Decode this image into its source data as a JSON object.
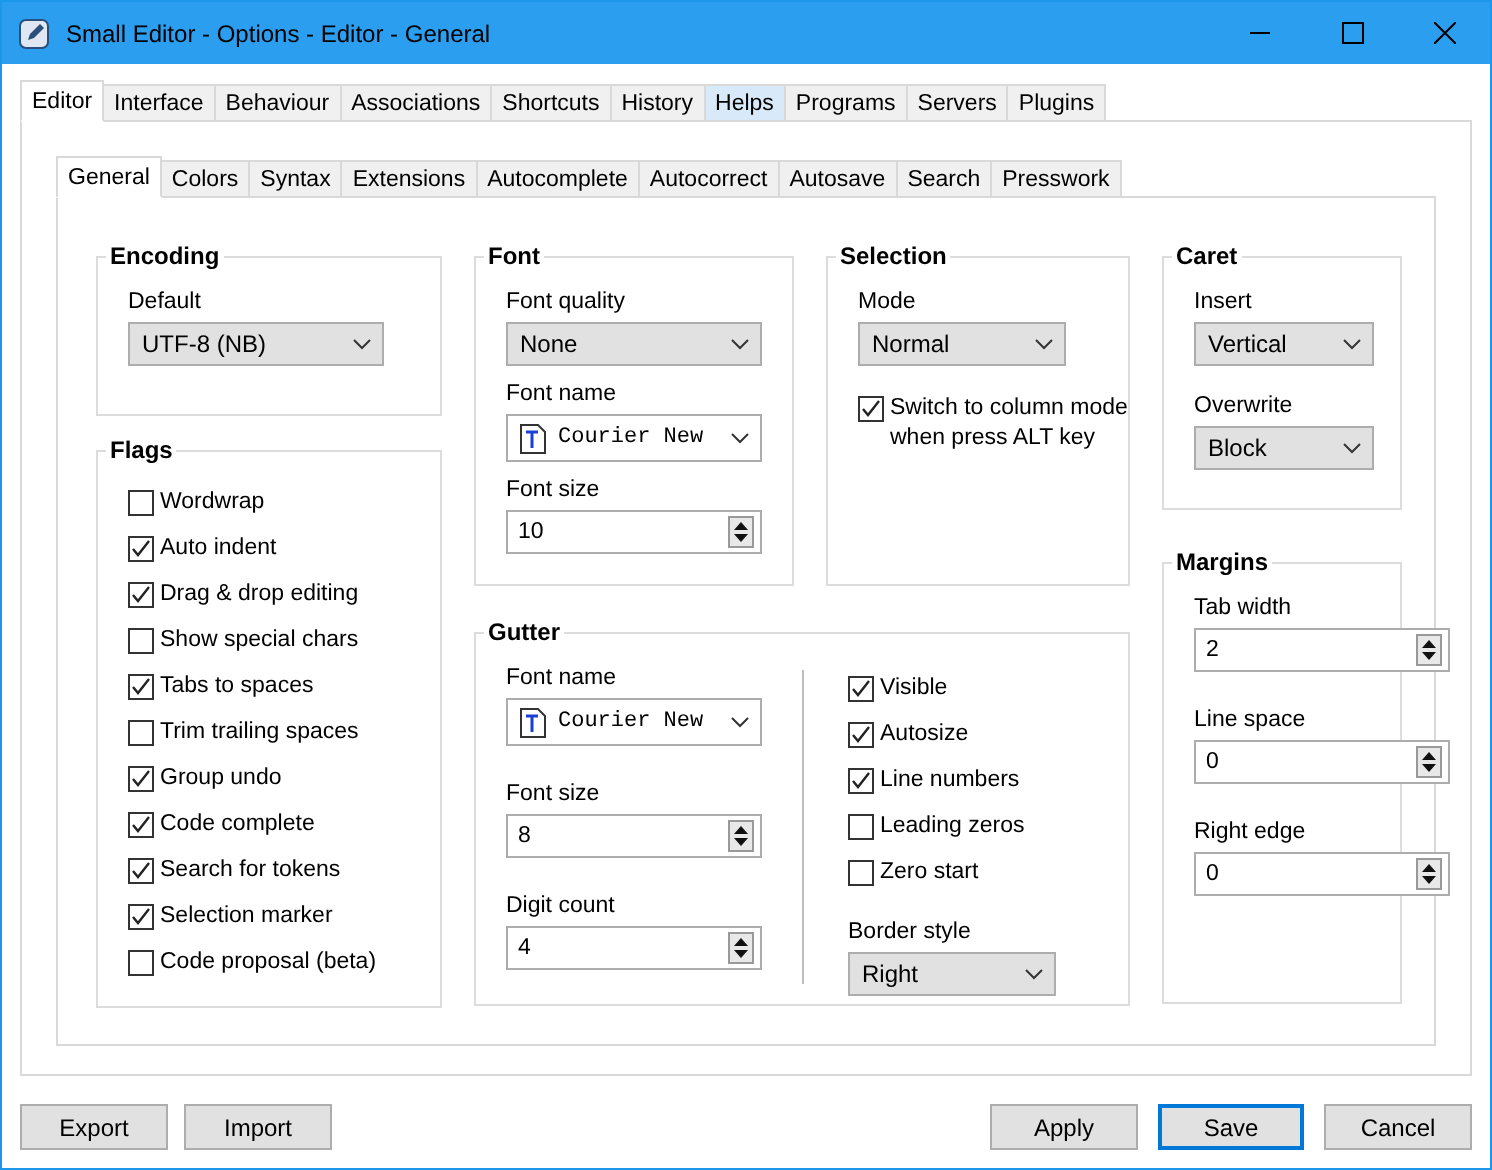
{
  "window": {
    "title": "Small Editor - Options - Editor - General"
  },
  "tabs": [
    {
      "label": "Editor",
      "selected": true,
      "hovered": false
    },
    {
      "label": "Interface",
      "selected": false,
      "hovered": false
    },
    {
      "label": "Behaviour",
      "selected": false,
      "hovered": false
    },
    {
      "label": "Associations",
      "selected": false,
      "hovered": false
    },
    {
      "label": "Shortcuts",
      "selected": false,
      "hovered": false
    },
    {
      "label": "History",
      "selected": false,
      "hovered": false
    },
    {
      "label": "Helps",
      "selected": false,
      "hovered": true
    },
    {
      "label": "Programs",
      "selected": false,
      "hovered": false
    },
    {
      "label": "Servers",
      "selected": false,
      "hovered": false
    },
    {
      "label": "Plugins",
      "selected": false,
      "hovered": false
    }
  ],
  "subtabs": [
    {
      "label": "General",
      "selected": true
    },
    {
      "label": "Colors",
      "selected": false
    },
    {
      "label": "Syntax",
      "selected": false
    },
    {
      "label": "Extensions",
      "selected": false
    },
    {
      "label": "Autocomplete",
      "selected": false
    },
    {
      "label": "Autocorrect",
      "selected": false
    },
    {
      "label": "Autosave",
      "selected": false
    },
    {
      "label": "Search",
      "selected": false
    },
    {
      "label": "Presswork",
      "selected": false
    }
  ],
  "encoding": {
    "title": "Encoding",
    "fields": [
      {
        "kind": "dropdown",
        "label": "Default",
        "value": "UTF-8 (NB)"
      }
    ]
  },
  "flags": {
    "title": "Flags",
    "items": [
      {
        "label": "Wordwrap",
        "checked": false
      },
      {
        "label": "Auto indent",
        "checked": true
      },
      {
        "label": "Drag & drop editing",
        "checked": true
      },
      {
        "label": "Show special chars",
        "checked": false
      },
      {
        "label": "Tabs to spaces",
        "checked": true
      },
      {
        "label": "Trim trailing spaces",
        "checked": false
      },
      {
        "label": "Group undo",
        "checked": true
      },
      {
        "label": "Code complete",
        "checked": true
      },
      {
        "label": "Search for tokens",
        "checked": true
      },
      {
        "label": "Selection marker",
        "checked": true
      },
      {
        "label": "Code proposal (beta)",
        "checked": false
      }
    ]
  },
  "font": {
    "title": "Font",
    "fields": [
      {
        "kind": "dropdown",
        "label": "Font quality",
        "value": "None"
      },
      {
        "kind": "font",
        "label": "Font name",
        "value": "Courier New"
      },
      {
        "kind": "spin",
        "label": "Font size",
        "value": "10"
      }
    ]
  },
  "selection": {
    "title": "Selection",
    "fields": [
      {
        "kind": "dropdown",
        "label": "Mode",
        "value": "Normal"
      }
    ],
    "column_mode": {
      "label": "Switch to column mode when press ALT key",
      "checked": true
    }
  },
  "caret": {
    "title": "Caret",
    "fields": [
      {
        "kind": "dropdown",
        "label": "Insert",
        "value": "Vertical"
      },
      {
        "kind": "dropdown",
        "label": "Overwrite",
        "value": "Block"
      }
    ]
  },
  "gutter": {
    "title": "Gutter",
    "fields": [
      {
        "kind": "font",
        "label": "Font name",
        "value": "Courier New"
      },
      {
        "kind": "spin",
        "label": "Font size",
        "value": "8"
      },
      {
        "kind": "spin",
        "label": "Digit count",
        "value": "4"
      }
    ],
    "options": [
      {
        "label": "Visible",
        "checked": true
      },
      {
        "label": "Autosize",
        "checked": true
      },
      {
        "label": "Line numbers",
        "checked": true
      },
      {
        "label": "Leading zeros",
        "checked": false
      },
      {
        "label": "Zero start",
        "checked": false
      }
    ],
    "border_style": {
      "kind": "dropdown",
      "label": "Border style",
      "value": "Right"
    }
  },
  "margins": {
    "title": "Margins",
    "fields": [
      {
        "kind": "spin",
        "label": "Tab width",
        "value": "2"
      },
      {
        "kind": "spin",
        "label": "Line space",
        "value": "0"
      },
      {
        "kind": "spin",
        "label": "Right edge",
        "value": "0"
      }
    ]
  },
  "left_buttons": [
    {
      "label": "Export",
      "default": false
    },
    {
      "label": "Import",
      "default": false
    }
  ],
  "right_buttons": [
    {
      "label": "Apply",
      "default": false
    },
    {
      "label": "Save",
      "default": true
    },
    {
      "label": "Cancel",
      "default": false
    }
  ]
}
